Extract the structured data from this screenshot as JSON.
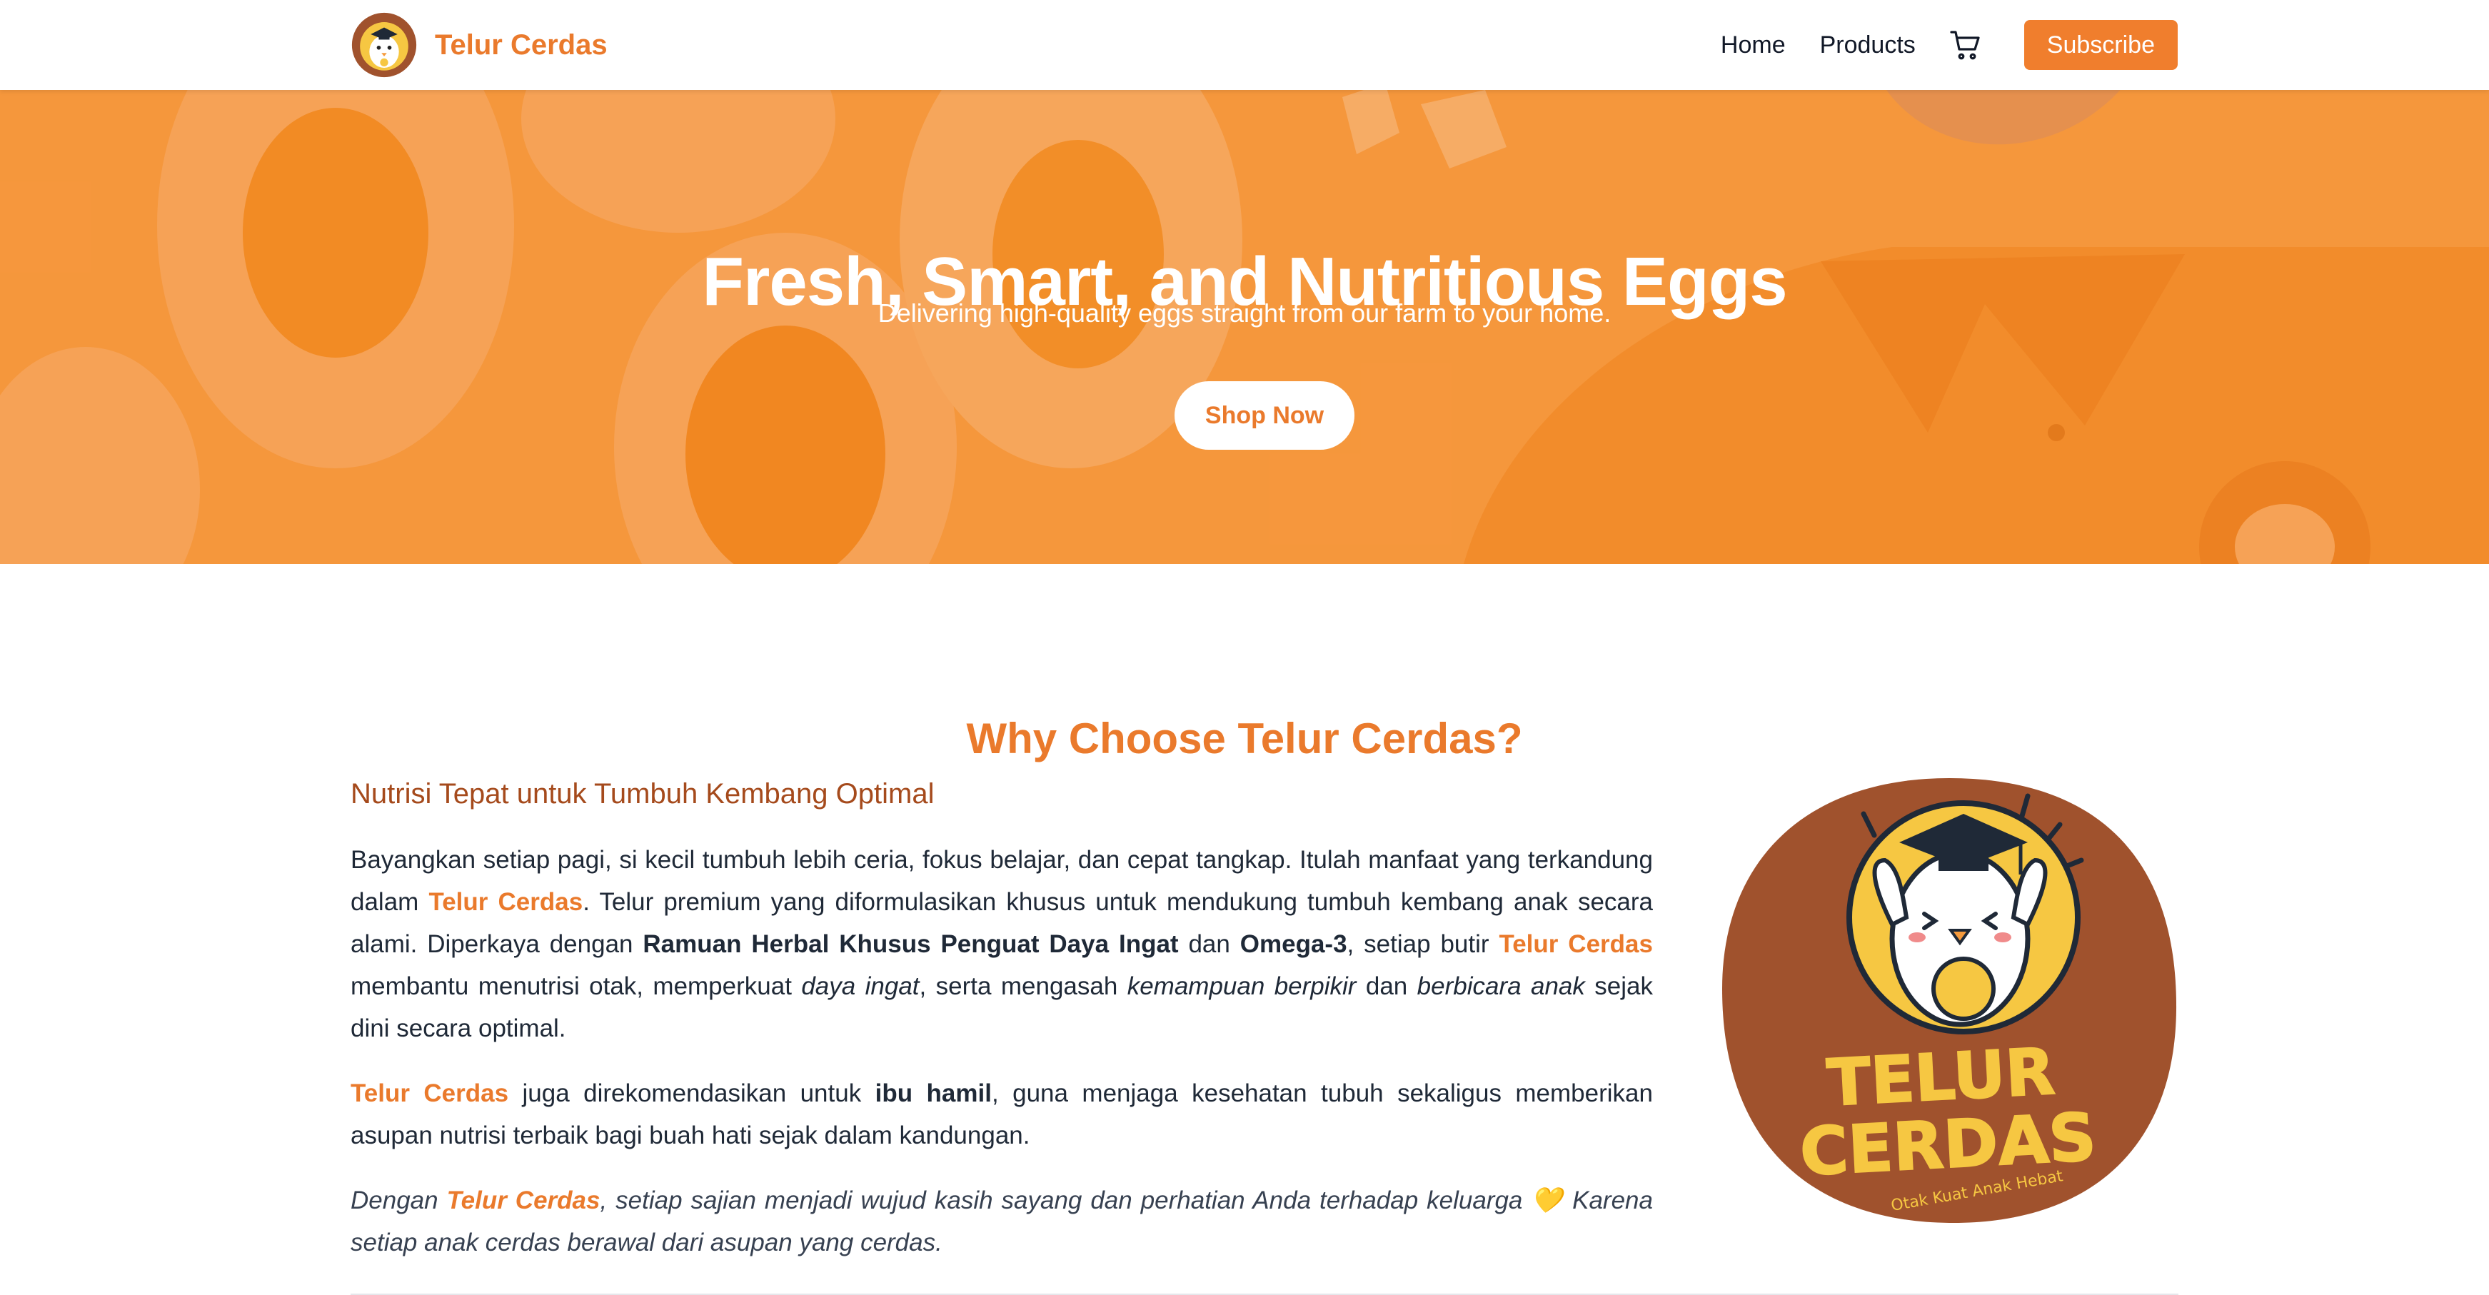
{
  "brand": {
    "name": "Telur Cerdas",
    "logo_icon": "chick-graduate-logo-icon",
    "accent": "#ea7a2c"
  },
  "nav": {
    "links": [
      "Home",
      "Products"
    ],
    "cart_icon": "cart-icon",
    "subscribe_label": "Subscribe",
    "button_color": "#f07e2d"
  },
  "hero": {
    "title": "Fresh, Smart, and Nutritious Eggs",
    "subtitle": "Delivering high-quality eggs straight from our farm to your home.",
    "cta_label": "Shop Now"
  },
  "why": {
    "title": "Why Choose Telur Cerdas?",
    "subtitle": "Nutrisi Tepat untuk Tumbuh Kembang Optimal",
    "p1": {
      "a": "Bayangkan setiap pagi, si kecil tumbuh lebih ceria, fokus belajar, dan cepat tangkap. Itulah manfaat yang terkandung dalam ",
      "brand1": "Telur Cerdas",
      "b": ". Telur premium yang diformulasikan khusus untuk mendukung tumbuh kembang anak secara alami. Diperkaya dengan ",
      "bold1": "Ramuan Herbal Khusus Penguat Daya Ingat",
      "c": " dan ",
      "bold2": "Omega-3",
      "d": ", setiap butir ",
      "brand2": "Telur Cerdas",
      "e": " membantu menutrisi otak, memperkuat ",
      "it1": "daya ingat",
      "f": ", serta mengasah ",
      "it2": "kemampuan berpikir",
      "g": " dan ",
      "it3": "berbicara anak",
      "h": " sejak dini secara optimal."
    },
    "p2": {
      "brand": "Telur Cerdas",
      "a": " juga direkomendasikan untuk ",
      "bold": "ibu hamil",
      "b": ", guna menjaga kesehatan tubuh sekaligus memberikan asupan nutrisi terbaik bagi buah hati sejak dalam kandungan."
    },
    "p3": {
      "a": "Dengan ",
      "brand": "Telur Cerdas",
      "b": ", setiap sajian menjadi wujud kasih sayang dan perhatian Anda terhadap keluarga 💛 Karena setiap anak cerdas berawal dari asupan yang cerdas."
    },
    "badge": {
      "line1": "TELUR",
      "line2": "CERDAS",
      "tagline": "Otak Kuat Anak Hebat",
      "bg_color": "#a0522d",
      "text_color": "#f6c742"
    }
  }
}
